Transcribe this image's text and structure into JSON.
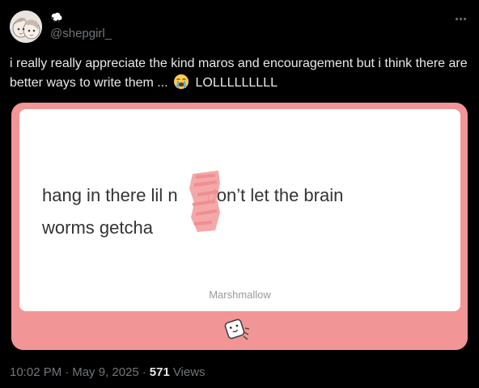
{
  "user": {
    "handle": "@shepgirl_",
    "name_icon": "sheep-emoji-icon",
    "avatar_icon": "anime-avatar-icon"
  },
  "tweet": {
    "text_before_emoji": "i really really appreciate the kind maros and encouragement but i think there are better ways to write them ...",
    "emoji": "loudly-crying-face-icon",
    "text_after_emoji": "LOLLLLLLLLL"
  },
  "media": {
    "message_line1_prefix": "hang in there lil n",
    "message_line1_suffix": "don’t let the brain",
    "message_line2": "worms getcha",
    "brand": "Marshmallow",
    "logo_icon": "marshmallow-logo-icon",
    "card_color": "#f29596",
    "censor_color": "#f2a0a0"
  },
  "footer": {
    "time": "10:02 PM",
    "separator": "·",
    "date": "May 9, 2025",
    "views_count": "571",
    "views_label": "Views"
  },
  "colors": {
    "background": "#000000",
    "text": "#e7e9ea",
    "secondary": "#71767b"
  }
}
